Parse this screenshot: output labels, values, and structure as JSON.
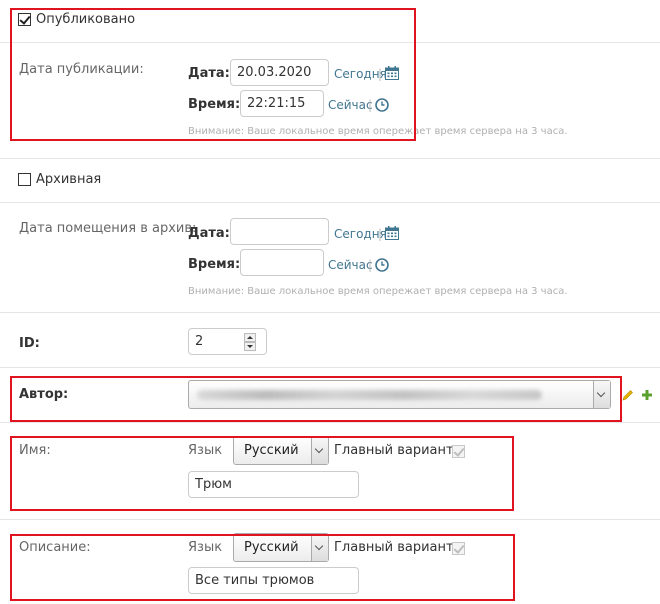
{
  "published": {
    "checkbox_label": "Опубликовано",
    "checked": true,
    "date_label": "Дата публикации:",
    "date_field_label": "Дата:",
    "date_value": "20.03.2020",
    "today_link": "Сегодня",
    "time_field_label": "Время:",
    "time_value": "22:21:15",
    "now_link": "Сейчас",
    "separator": "|",
    "help": "Внимание: Ваше локальное время опережает время сервера на 3 часа."
  },
  "archive": {
    "checkbox_label": "Архивная",
    "checked": false,
    "date_label": "Дата помещения в архив:",
    "date_field_label": "Дата:",
    "date_value": "",
    "today_link": "Сегодня",
    "time_field_label": "Время:",
    "time_value": "",
    "now_link": "Сейчас",
    "separator": "|",
    "help": "Внимание: Ваше локальное время опережает время сервера на 3 часа."
  },
  "id_field": {
    "label": "ID:",
    "value": "2"
  },
  "author": {
    "label": "Автор:"
  },
  "name": {
    "label": "Имя:",
    "lang_label": "Язык",
    "lang_value": "Русский",
    "main_variant_label": "Главный вариант",
    "main_variant_checked": true,
    "value": "Трюм"
  },
  "description": {
    "label": "Описание:",
    "lang_label": "Язык",
    "lang_value": "Русский",
    "main_variant_label": "Главный вариант",
    "main_variant_checked": true,
    "value": "Все типы трюмов"
  },
  "colors": {
    "link": "#417690",
    "highlight_border": "#e0141e",
    "edit_icon": "#e8b400",
    "add_icon": "#5aa02c"
  },
  "icons": [
    "calendar-icon",
    "clock-icon",
    "edit-pencil-icon",
    "add-plus-icon",
    "spinner-arrows-icon"
  ]
}
